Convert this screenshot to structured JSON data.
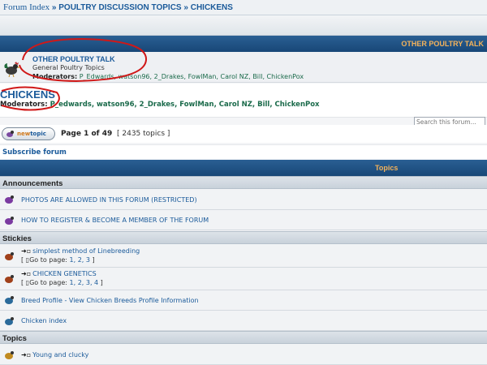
{
  "breadcrumb": {
    "items": [
      "Forum Index",
      "POULTRY DISCUSSION TOPICS",
      "CHICKENS"
    ],
    "separator": "»"
  },
  "subforum_section": {
    "header": "OTHER POULTRY TALK",
    "title": "OTHER POULTRY TALK",
    "description": "General Poultry Topics",
    "moderators_label": "Moderators:",
    "moderators": "P_Edwards, watson96, 2_Drakes, FowlMan, Carol NZ, Bill, ChickenPox"
  },
  "forum": {
    "name": "CHICKENS",
    "moderators_label": "Moderators:",
    "moderators": "P_edwards, watson96, 2_Drakes, FowlMan, Carol NZ, Bill, ChickenPox",
    "search_placeholder": "Search this forum..."
  },
  "pager": {
    "new_topic_prefix": "new",
    "new_topic_suffix": "topic",
    "page_text": "Page 1 of 49",
    "topic_count": "[ 2435 topics ]"
  },
  "subscribe_label": "Subscribe forum",
  "topics_header": "Topics",
  "categories": {
    "announcements": "Announcements",
    "stickies": "Stickies",
    "topics": "Topics"
  },
  "announcements": [
    "PHOTOS ARE ALLOWED IN THIS FORUM (RESTRICTED)",
    "HOW TO REGISTER & BECOME A MEMBER OF THE FORUM"
  ],
  "stickies": [
    {
      "title": "simplest method of Linebreeding",
      "goto": "Go to page:",
      "pages": "1, 2, 3"
    },
    {
      "title": "CHICKEN GENETICS",
      "goto": "Go to page:",
      "pages": "1, 2, 3, 4"
    },
    {
      "title": "Breed Profile - View Chicken Breeds Profile Information"
    },
    {
      "title": "Chicken index"
    }
  ],
  "topics": [
    {
      "title": "Young and clucky"
    }
  ],
  "colors": {
    "header_blue": "#184777",
    "header_text_orange": "#f4b25a",
    "link_blue": "#1a5a9a",
    "moderator_green": "#1a6a4a"
  }
}
